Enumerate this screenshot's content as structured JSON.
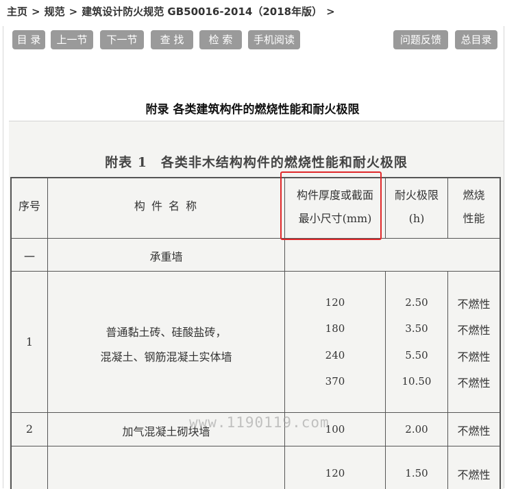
{
  "breadcrumb": {
    "home": "主页",
    "sep": ">",
    "section": "规范",
    "doc": "建筑设计防火规范 GB50016-2014（2018年版）"
  },
  "toolbar": {
    "contents": "目 录",
    "prev": "上一节",
    "next": "下一节",
    "find": "查 找",
    "search": "检 索",
    "mobile": "手机阅读",
    "feedback": "问题反馈",
    "index": "总目录"
  },
  "page": {
    "title": "附录 各类建筑构件的燃烧性能和耐火极限"
  },
  "table": {
    "title": "附表 1　各类非木结构构件的燃烧性能和耐火极限",
    "headers": {
      "no": "序号",
      "name": "构 件 名 称",
      "thickness_1": "构件厚度或截面",
      "thickness_2": "最小尺寸(mm)",
      "limit_1": "耐火极限",
      "limit_2": "(h)",
      "burn_1": "燃烧",
      "burn_2": "性能"
    },
    "group": {
      "no": "一",
      "name": "承重墙"
    },
    "rows": [
      {
        "no": "1",
        "name_1": "普通黏土砖、硅酸盐砖，",
        "name_2": "混凝土、钢筋混凝土实体墙",
        "entries": [
          {
            "size": "120",
            "limit": "2.50",
            "burn": "不燃性"
          },
          {
            "size": "180",
            "limit": "3.50",
            "burn": "不燃性"
          },
          {
            "size": "240",
            "limit": "5.50",
            "burn": "不燃性"
          },
          {
            "size": "370",
            "limit": "10.50",
            "burn": "不燃性"
          }
        ]
      },
      {
        "no": "2",
        "name_1": "加气混凝土砌块墙",
        "entries": [
          {
            "size": "100",
            "limit": "2.00",
            "burn": "不燃性"
          }
        ]
      },
      {
        "entries": [
          {
            "size": "120",
            "limit": "1.50",
            "burn": "不燃性"
          }
        ]
      }
    ]
  },
  "watermark": "www.1190119.com",
  "colors": {
    "button_bg": "#9a9a9a",
    "highlight_box": "#e0282a"
  }
}
